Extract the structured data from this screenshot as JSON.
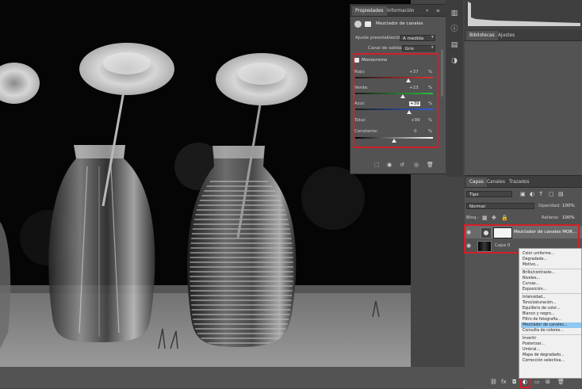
{
  "properties_panel": {
    "tabs": [
      "Propiedades",
      "Información"
    ],
    "collapse_glyph": "»",
    "menu_glyph": "≡",
    "adjustment_title": "Mezclador de canales",
    "preset_label": "Ajuste preestablecido:",
    "preset_value": "A medida",
    "output_label": "Canal de salida:",
    "output_value": "Gris",
    "monochrome_label": "Monocromo",
    "channels": [
      {
        "label": "Rojo:",
        "value": "+37",
        "unit": "%",
        "level": 0.685
      },
      {
        "label": "Verde:",
        "value": "+23",
        "unit": "%",
        "level": 0.615
      },
      {
        "label": "Azul:",
        "value": "+39",
        "unit": "%",
        "level": 0.695
      }
    ],
    "total_label": "Total:",
    "total_value": "+99",
    "total_unit": "%",
    "constant_label": "Constante:",
    "constant_value": "0",
    "constant_unit": "%",
    "constant_level": 0.5
  },
  "libraries_panel": {
    "tabs": [
      "Bibliotecas",
      "Ajustes"
    ]
  },
  "layers_panel": {
    "tabs": [
      "Capas",
      "Canales",
      "Trazados"
    ],
    "filter_value": "Tipo",
    "blend_mode": "Normal",
    "opacity_label": "Opacidad:",
    "opacity_value": "100%",
    "lock_label": "Bloq.:",
    "fill_label": "Relleno:",
    "fill_value": "100%",
    "layers": [
      {
        "name": "Mezclador de canales MOR...",
        "visible": true
      },
      {
        "name": "Capa 0",
        "visible": true
      }
    ]
  },
  "adjustment_menu": {
    "items": [
      "Color uniforme...",
      "Degradado...",
      "Motivo...",
      "Brillo/contraste...",
      "Niveles...",
      "Curvas...",
      "Exposición...",
      "Intensidad...",
      "Tono/saturación...",
      "Equilibrio de color...",
      "Blanco y negro...",
      "Filtro de fotografía...",
      "Mezclador de canales...",
      "Consulta de colores...",
      "Invertir",
      "Posterizar...",
      "Umbral...",
      "Mapa de degradado...",
      "Corrección selectiva..."
    ],
    "selected": "Mezclador de canales..."
  },
  "colors": {
    "highlight_red": "#d21f2a",
    "menu_selection": "#90c8f0",
    "panel_bg": "#535353"
  }
}
